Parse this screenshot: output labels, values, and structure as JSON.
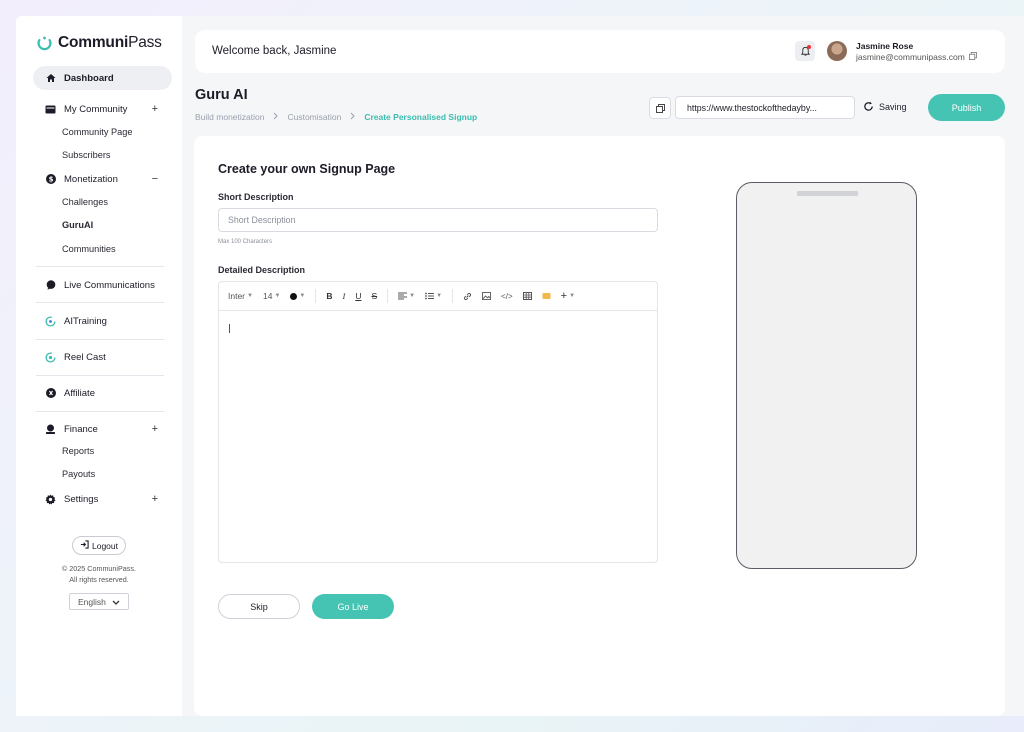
{
  "brand": {
    "name_part1": "Communi",
    "name_part2": "Pass",
    "accent": "#45c4b4"
  },
  "sidebar": {
    "dashboard": "Dashboard",
    "my_community": "My Community",
    "community_page": "Community Page",
    "subscribers": "Subscribers",
    "monetization": "Monetization",
    "challenges": "Challenges",
    "guruai": "GuruAI",
    "communities": "Communities",
    "live_communications": "Live Communications",
    "ai_training": "AITraining",
    "reel_cast": "Reel Cast",
    "affiliate": "Affiliate",
    "finance": "Finance",
    "reports": "Reports",
    "payouts": "Payouts",
    "settings": "Settings",
    "logout": "Logout",
    "copyright_line1": "© 2025 CommuniPass.",
    "copyright_line2": "All rights reserved.",
    "language": "English"
  },
  "header": {
    "welcome": "Welcome back, Jasmine",
    "user_name": "Jasmine Rose",
    "user_email": "jasmine@communipass.com"
  },
  "page": {
    "title": "Guru AI",
    "breadcrumb": [
      "Build monetization",
      "Customisation",
      "Create Personalised Signup"
    ],
    "url": "https://www.thestockofthedayby...",
    "saving": "Saving",
    "publish": "Publish"
  },
  "form": {
    "title": "Create your own Signup Page",
    "short_label": "Short Description",
    "short_placeholder": "Short Description",
    "short_hint": "Max 100 Characters",
    "detailed_label": "Detailed Description",
    "font": "Inter",
    "font_size": "14",
    "skip": "Skip",
    "go_live": "Go Live"
  }
}
